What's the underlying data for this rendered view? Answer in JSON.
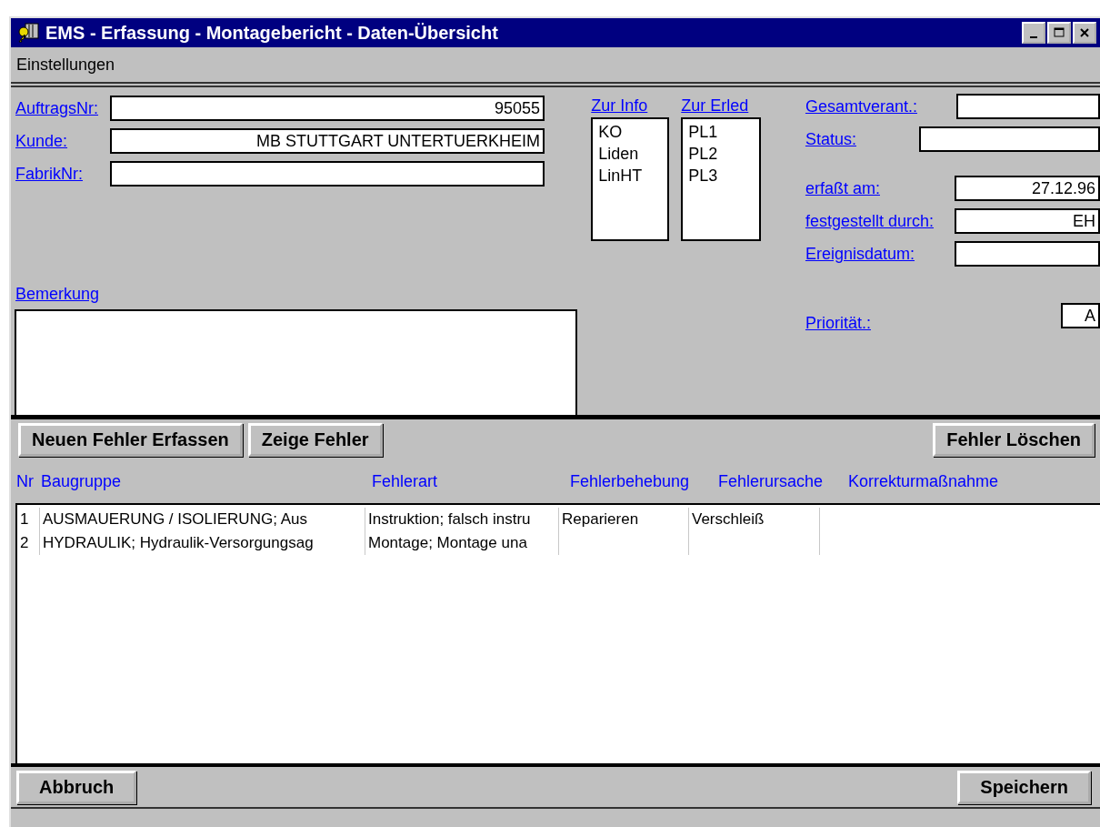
{
  "window": {
    "title": "EMS - Erfassung - Montagebericht - Daten-Übersicht"
  },
  "menu": [
    {
      "label": "Einstellungen"
    }
  ],
  "order_fields": [
    {
      "label": "AuftragsNr:",
      "value": "95055"
    },
    {
      "label": "Kunde:",
      "value": "MB STUTTGART UNTERTUERKHEIM"
    },
    {
      "label": "FabrikNr:"
    }
  ],
  "remark": {
    "label": "Bemerkung"
  },
  "lists": [
    {
      "label": "Zur Info",
      "items": [
        "KO",
        "Liden",
        "LinHT"
      ]
    },
    {
      "label": "Zur Erled",
      "items": [
        "PL1",
        "PL2",
        "PL3"
      ]
    }
  ],
  "detail_fields": [
    {
      "label": "Gesamtverant.:"
    },
    {
      "label": "Status:"
    },
    {
      "label": "erfaßt am:",
      "value": "27.12.96"
    },
    {
      "label": "festgestellt durch:",
      "value": "EH"
    },
    {
      "label": "Ereignisdatum:"
    }
  ],
  "priority": {
    "label": "Priorität.:",
    "value": "A"
  },
  "toolbar": {
    "left": [
      "Neuen Fehler Erfassen",
      "Zeige Fehler"
    ],
    "right": [
      "Fehler Löschen"
    ]
  },
  "table": {
    "columns": [
      "Nr",
      "Baugruppe",
      "Fehlerart",
      "Fehlerbehebung",
      "Fehlerursache",
      "Korrekturmaßnahme"
    ],
    "rows": [
      [
        "1",
        "AUSMAUERUNG / ISOLIERUNG; Aus",
        "Instruktion; falsch instru",
        "Reparieren",
        "Verschleiß"
      ],
      [
        "2",
        "HYDRAULIK; Hydraulik-Versorgungsag",
        "Montage; Montage una",
        "",
        ""
      ]
    ]
  },
  "footer": {
    "left": "Abbruch",
    "right": "Speichern"
  }
}
